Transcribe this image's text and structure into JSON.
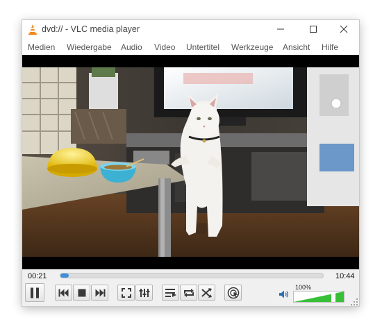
{
  "window": {
    "title": "dvd:// - VLC media player"
  },
  "menu": {
    "items": [
      "Medien",
      "Wiedergabe",
      "Audio",
      "Video",
      "Untertitel",
      "Werkzeuge",
      "Ansicht",
      "Hilfe"
    ]
  },
  "playback": {
    "elapsed": "00:21",
    "total": "10:44",
    "progress": 0.033
  },
  "volume": {
    "label": "100%",
    "level": 1.0
  },
  "icons": {
    "app": "vlc-cone-icon",
    "minimize": "minimize-icon",
    "maximize": "maximize-icon",
    "close": "close-icon",
    "pause": "pause-icon",
    "previous": "skip-previous-icon",
    "stop": "stop-icon",
    "next": "skip-next-icon",
    "fullscreen": "fullscreen-icon",
    "extended": "extended-settings-icon",
    "playlist": "playlist-icon",
    "loop": "loop-icon",
    "shuffle": "shuffle-icon",
    "frame": "frame-by-frame-icon",
    "volume": "speaker-icon"
  },
  "colors": {
    "accent": "#3f8fd8",
    "volume_green": "#37c037"
  }
}
